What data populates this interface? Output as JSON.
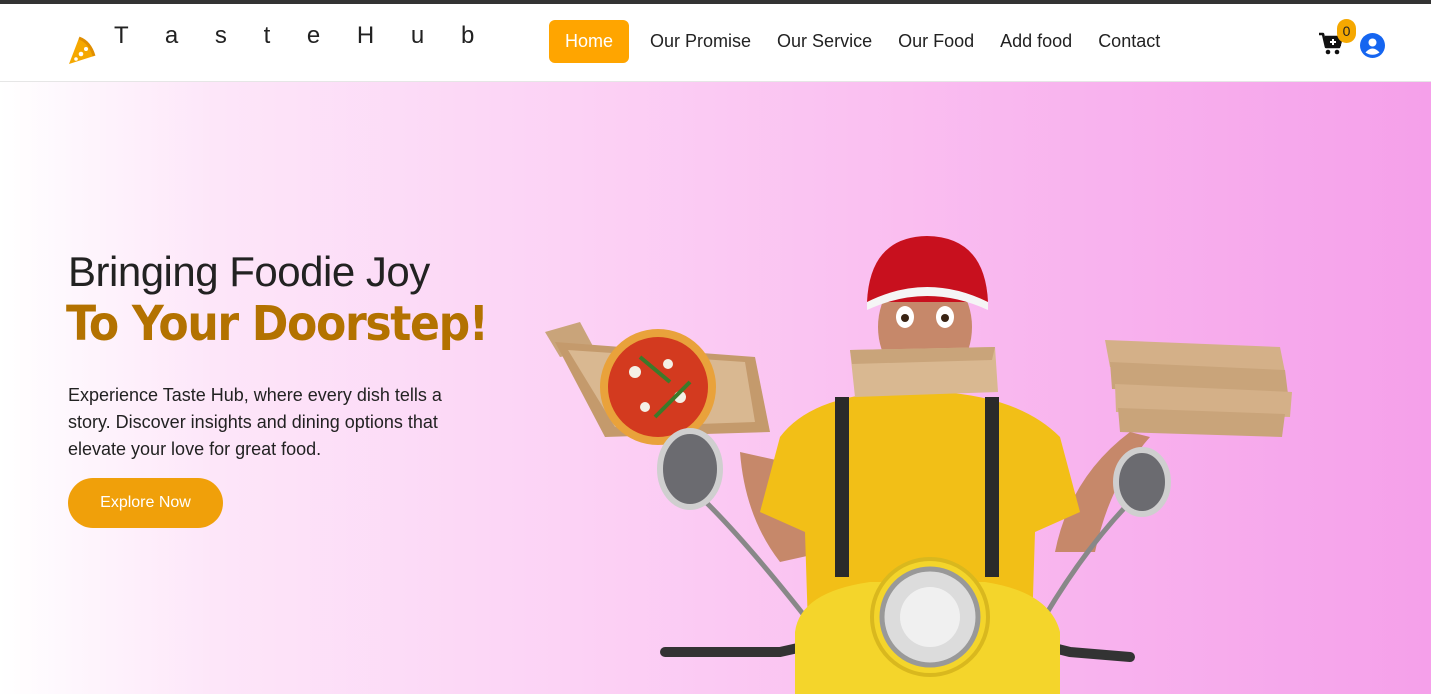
{
  "brand": {
    "name": "T a s t e H u b",
    "logo_icon": "pizza-slice-icon"
  },
  "nav": {
    "items": [
      {
        "label": "Home",
        "active": true
      },
      {
        "label": "Our Promise",
        "active": false
      },
      {
        "label": "Our Service",
        "active": false
      },
      {
        "label": "Our Food",
        "active": false
      },
      {
        "label": "Add food",
        "active": false
      },
      {
        "label": "Contact",
        "active": false
      }
    ],
    "cart_icon": "cart-plus-icon",
    "cart_count": "0",
    "user_icon": "user-circle-icon"
  },
  "hero": {
    "title_line1": "Bringing Foodie Joy",
    "title_line2": "To Your Doorstep!",
    "description": "Experience Taste Hub, where every dish tells a story. Discover insights and dining options that elevate your love for great food.",
    "cta_label": "Explore Now"
  },
  "colors": {
    "accent": "#ffa500",
    "title_accent": "#b37200",
    "button": "#f0a00a",
    "hero_gradient_end": "#f5a0ea"
  }
}
